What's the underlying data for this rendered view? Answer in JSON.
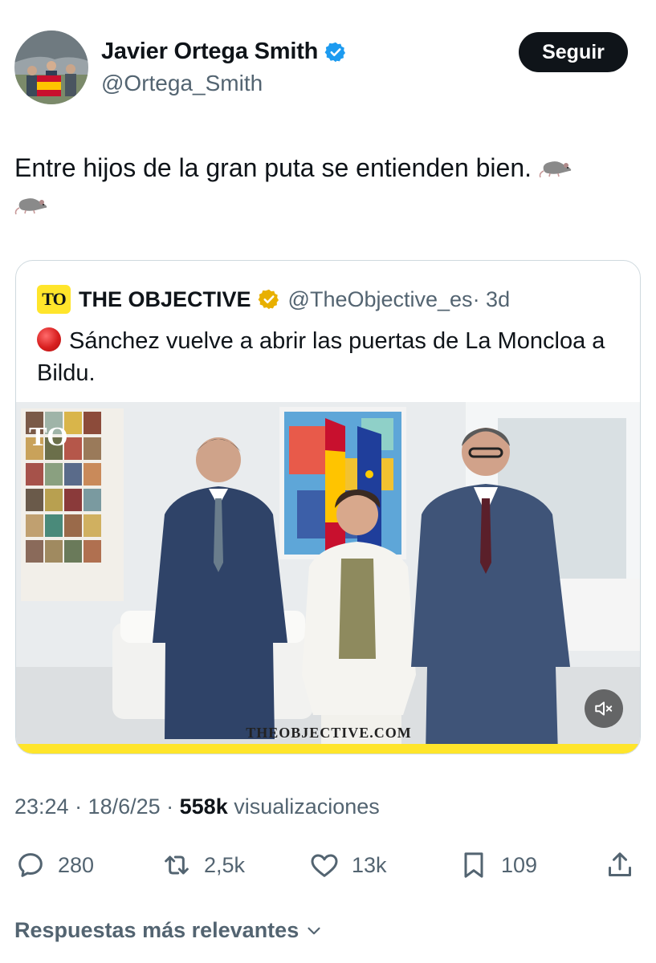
{
  "author": {
    "name": "Javier Ortega Smith",
    "handle": "@Ortega_Smith",
    "verified_icon": "verified-badge-icon"
  },
  "follow_button": {
    "label": "Seguir"
  },
  "tweet": {
    "text": "Entre hijos de la gran puta se entienden bien.",
    "emojis": [
      "rat-emoji",
      "rat-emoji"
    ]
  },
  "quote": {
    "logo_text": "TO",
    "name": "THE OBJECTIVE",
    "handle": "@TheObjective_es",
    "time": "· 3d",
    "status_icon": "red-circle-icon",
    "text": "Sánchez vuelve a abrir las puertas de La Moncloa a Bildu.",
    "media": {
      "corner_logo": "TO",
      "watermark": "THEOBJECTIVE.COM",
      "mute_icon": "speaker-muted-icon"
    }
  },
  "meta": {
    "time": "23:24 · 18/6/25 · ",
    "views_count": "558k",
    "views_label": " visualizaciones"
  },
  "actions": {
    "replies": "280",
    "reposts": "2,5k",
    "likes": "13k",
    "bookmarks": "109"
  },
  "replies_sort": {
    "label": "Respuestas más relevantes"
  },
  "colors": {
    "text": "#0f1419",
    "secondary": "#536471",
    "verified_blue": "#1d9bf0",
    "verified_gold": "#e8b000",
    "brand_yellow": "#ffe52b"
  }
}
